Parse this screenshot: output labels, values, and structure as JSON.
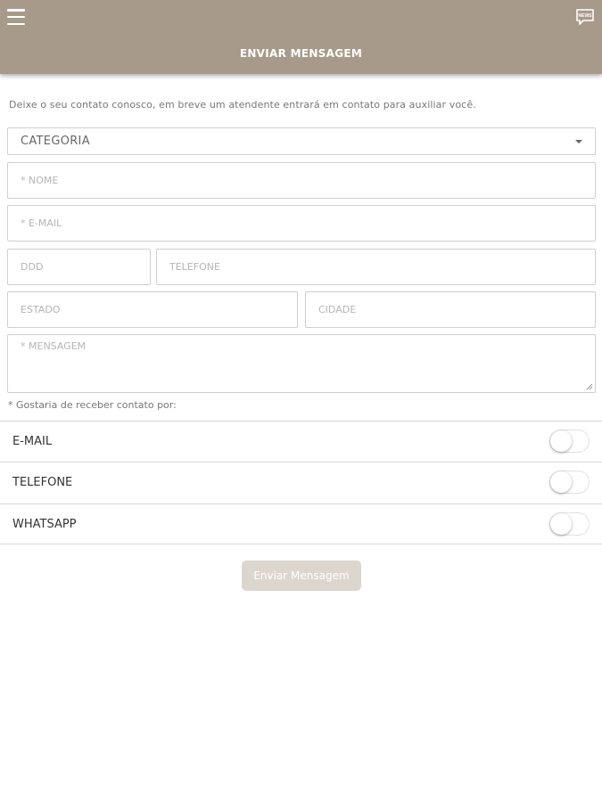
{
  "header": {
    "title": "ENVIAR MENSAGEM",
    "menu_icon": "hamburger-menu-icon",
    "news_icon": "news-chat-icon",
    "news_icon_text": "NEWS",
    "background": "#a89a8a"
  },
  "form": {
    "intro": "Deixe o seu contato conosco, em breve um atendente entrará em contato para auxiliar você.",
    "category": "CATEGORIA",
    "name_placeholder": "* NOME",
    "email_placeholder": "* E-MAIL",
    "ddd_placeholder": "DDD",
    "phone_placeholder": "TELEFONE",
    "state_placeholder": "ESTADO",
    "city_placeholder": "CIDADE",
    "message_placeholder": "* MENSAGEM"
  },
  "preferences": {
    "label": "* Gostaria de receber contato por:",
    "options": [
      {
        "label": "E-MAIL",
        "enabled": false
      },
      {
        "label": "TELEFONE",
        "enabled": false
      },
      {
        "label": "WHATSAPP",
        "enabled": false
      }
    ]
  },
  "submit": {
    "label": "Enviar Mensagem",
    "color": "#dcd6cf"
  }
}
